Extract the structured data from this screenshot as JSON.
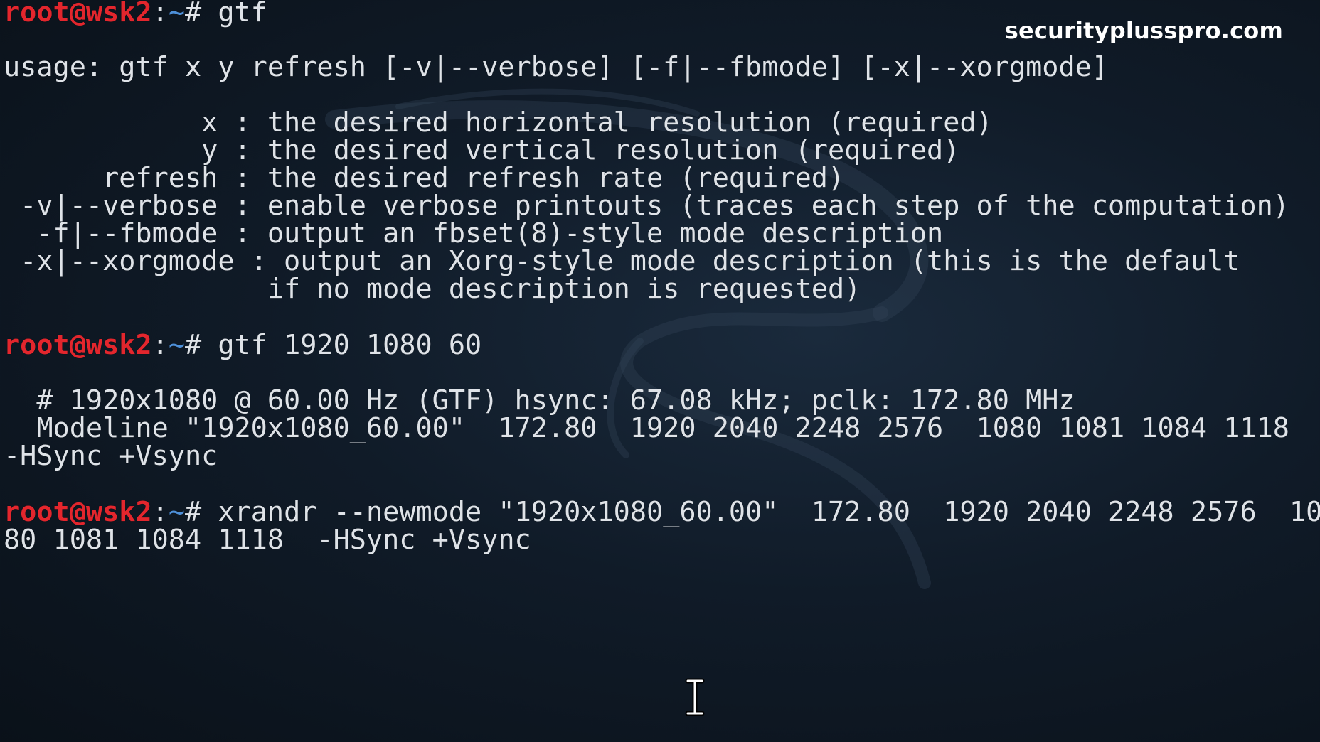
{
  "watermark": "securityplusspro.com",
  "prompt": {
    "user": "root@wsk2",
    "colon": ":",
    "dir": "~",
    "hash": "# "
  },
  "cmd1": "gtf",
  "usage_line": "usage: gtf x y refresh [-v|--verbose] [-f|--fbmode] [-x|--xorgmode]",
  "help_lines": [
    "            x : the desired horizontal resolution (required)",
    "            y : the desired vertical resolution (required)",
    "      refresh : the desired refresh rate (required)",
    " -v|--verbose : enable verbose printouts (traces each step of the computation)",
    "  -f|--fbmode : output an fbset(8)-style mode description",
    " -x|--xorgmode : output an Xorg-style mode description (this is the default",
    "                if no mode description is requested)"
  ],
  "cmd2": "gtf 1920 1080 60",
  "gtf_output": [
    "  # 1920x1080 @ 60.00 Hz (GTF) hsync: 67.08 kHz; pclk: 172.80 MHz",
    "  Modeline \"1920x1080_60.00\"  172.80  1920 2040 2248 2576  1080 1081 1084 1118",
    "-HSync +Vsync"
  ],
  "cmd3": "xrandr --newmode \"1920x1080_60.00\"  172.80  1920 2040 2248 2576  10",
  "cmd3_cont": "80 1081 1084 1118  -HSync +Vsync",
  "icons": {
    "cursor": "text-cursor-icon",
    "watermark_bg": "kali-dragon-watermark"
  },
  "colors": {
    "user": "#e3262d",
    "tilde": "#4d8fd8",
    "text": "#dfe3e8",
    "background": "#101b28"
  }
}
